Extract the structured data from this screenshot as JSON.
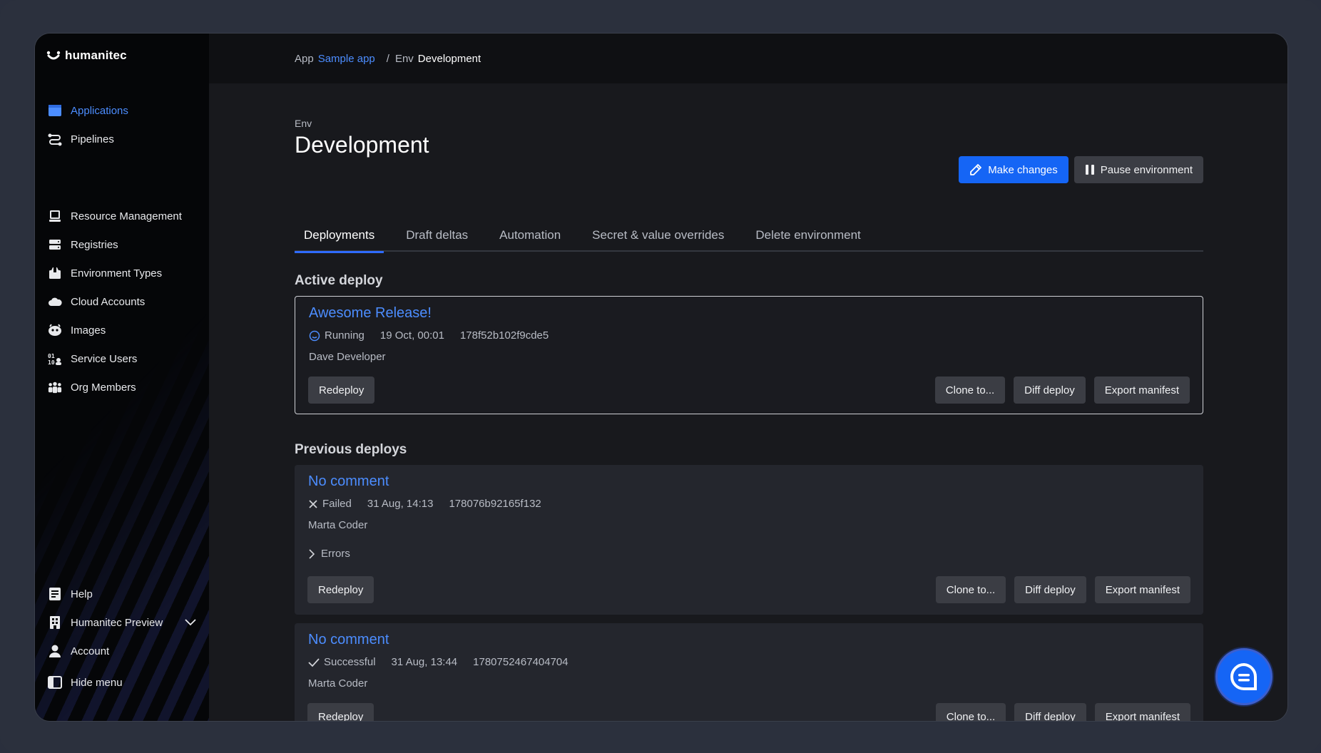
{
  "brand": {
    "name": "humanitec"
  },
  "sidebar": {
    "primary": [
      {
        "label": "Applications",
        "icon": "applications-icon",
        "active": true
      },
      {
        "label": "Pipelines",
        "icon": "pipelines-icon"
      }
    ],
    "secondary": [
      {
        "label": "Resource Management",
        "icon": "resource-management-icon"
      },
      {
        "label": "Registries",
        "icon": "registries-icon"
      },
      {
        "label": "Environment Types",
        "icon": "environment-types-icon"
      },
      {
        "label": "Cloud Accounts",
        "icon": "cloud-accounts-icon"
      },
      {
        "label": "Images",
        "icon": "images-icon"
      },
      {
        "label": "Service Users",
        "icon": "service-users-icon"
      },
      {
        "label": "Org Members",
        "icon": "org-members-icon"
      }
    ],
    "bottom": [
      {
        "label": "Help",
        "icon": "help-icon"
      },
      {
        "label": "Humanitec Preview",
        "icon": "organization-icon"
      },
      {
        "label": "Account",
        "icon": "account-icon"
      }
    ],
    "hide_menu": "Hide menu"
  },
  "breadcrumb": {
    "app_label": "App",
    "app_name": "Sample app",
    "separator": "/",
    "env_label": "Env",
    "env_name": "Development"
  },
  "header": {
    "env_label": "Env",
    "title": "Development",
    "make_changes": "Make changes",
    "pause_environment": "Pause environment"
  },
  "tabs": [
    {
      "label": "Deployments",
      "active": true
    },
    {
      "label": "Draft deltas"
    },
    {
      "label": "Automation"
    },
    {
      "label": "Secret & value overrides"
    },
    {
      "label": "Delete environment"
    }
  ],
  "active_deploy": {
    "section_title": "Active deploy",
    "title": "Awesome Release!",
    "status": "Running",
    "time": "19 Oct, 00:01",
    "id": "178f52b102f9cde5",
    "author": "Dave Developer"
  },
  "previous_deploys": {
    "section_title": "Previous deploys",
    "items": [
      {
        "title": "No comment",
        "status": "Failed",
        "time": "31 Aug, 14:13",
        "id": "178076b92165f132",
        "author": "Marta Coder",
        "errors_label": "Errors"
      },
      {
        "title": "No comment",
        "status": "Successful",
        "time": "31 Aug, 13:44",
        "id": "1780752467404704",
        "author": "Marta Coder"
      }
    ]
  },
  "actions": {
    "redeploy": "Redeploy",
    "clone": "Clone to...",
    "diff": "Diff deploy",
    "export": "Export manifest"
  },
  "colors": {
    "accent": "#4c8dff",
    "primary_button": "#1565f5",
    "sidebar_bg": "#050608",
    "card_bg": "#24262d"
  }
}
